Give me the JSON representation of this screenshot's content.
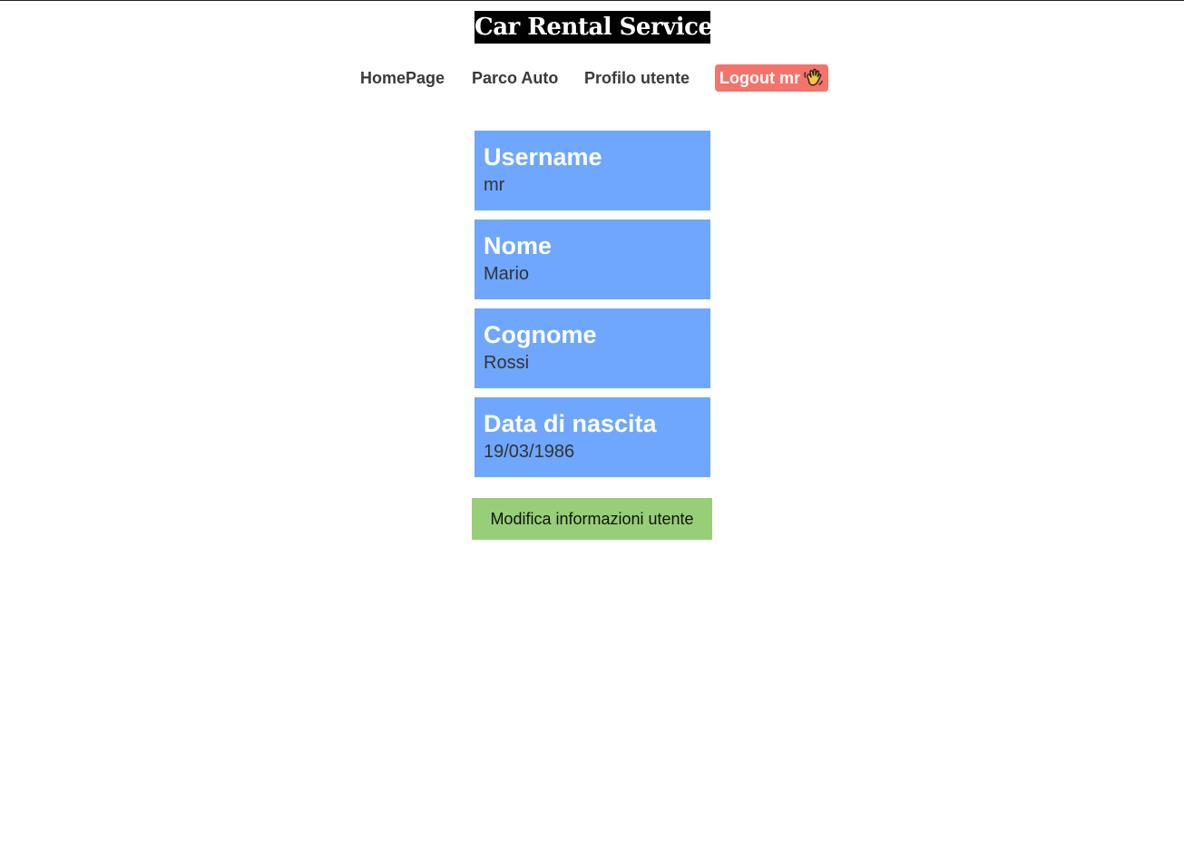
{
  "header": {
    "title": "Car Rental Service"
  },
  "nav": {
    "home": "HomePage",
    "fleet": "Parco Auto",
    "profile": "Profilo utente",
    "logout": "Logout mr",
    "logout_icon": "waving-hand-icon"
  },
  "profile": {
    "fields": [
      {
        "label": "Username",
        "value": "mr"
      },
      {
        "label": "Nome",
        "value": "Mario"
      },
      {
        "label": "Cognome",
        "value": "Rossi"
      },
      {
        "label": "Data di nascita",
        "value": "19/03/1986"
      }
    ],
    "edit_button": "Modifica informazioni utente"
  },
  "colors": {
    "card_background": "#6ea7fd",
    "logout_background": "#f4736b",
    "edit_button_background": "#97cf78",
    "title_background": "#000000"
  }
}
